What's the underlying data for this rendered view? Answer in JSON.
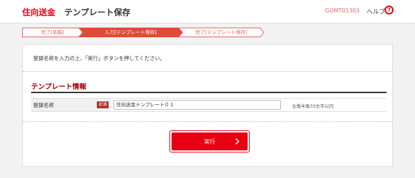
{
  "header": {
    "brand": "住向送金",
    "title": "テンプレート保存",
    "screen_id": "GOMT01303",
    "help_label": "ヘルプ",
    "help_icon": "question-icon"
  },
  "steps": [
    {
      "label": "完了[依頼]",
      "state": "done"
    },
    {
      "label": "入力[テンプレート保存]",
      "state": "current"
    },
    {
      "label": "完了[テンプレート保存]",
      "state": "pending"
    }
  ],
  "instruction": "登録名称を入力の上、「実行」ボタンを押してください。",
  "section": {
    "title": "テンプレート情報"
  },
  "form": {
    "label": "登録名称",
    "required": "必須",
    "value": "住向送金テンプレート０１",
    "hint": "全角半角33文字以内"
  },
  "execute": {
    "label": "実行",
    "icon": "chevron-right-icon"
  },
  "colors": {
    "accent": "#e60012",
    "section_title": "#a00000",
    "badge": "#b03030",
    "background": "#f2f2f2"
  }
}
